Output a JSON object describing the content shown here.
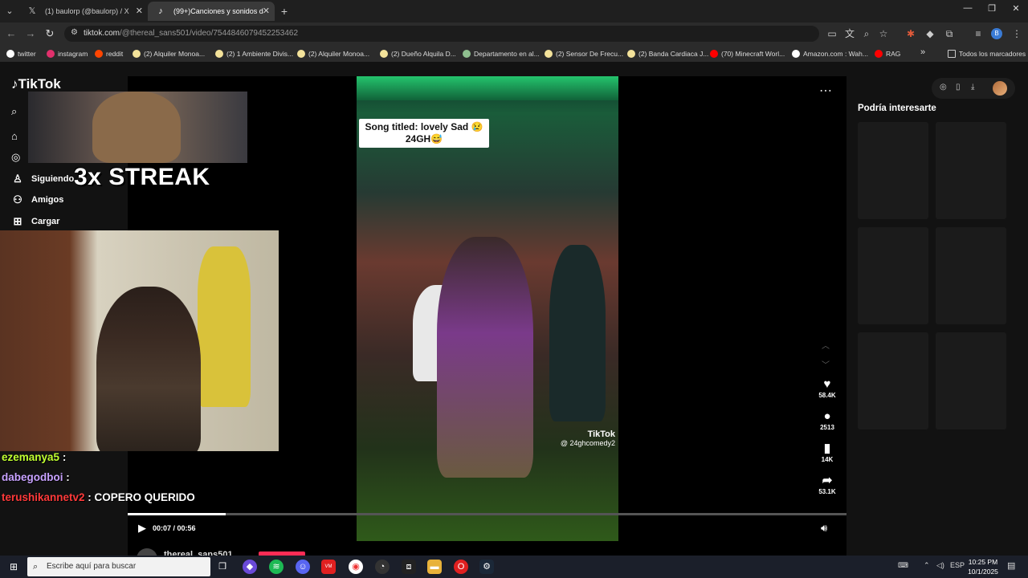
{
  "browser": {
    "tabs": [
      {
        "title": "(1) baulorp (@baulorp) / X",
        "icon": "x-logo-icon"
      },
      {
        "title": "(99+)Canciones y sonidos d",
        "icon": "tiktok-icon"
      }
    ],
    "url_domain": "tiktok.com",
    "url_path": "/@thereal_sans501/video/7544846079452253462",
    "bookmarks": [
      {
        "label": "twitter",
        "color": "#ffffff"
      },
      {
        "label": "instagram",
        "color": "#e1306c"
      },
      {
        "label": "reddit",
        "color": "#ff4500"
      },
      {
        "label": "(2) Alquiler Monoa...",
        "color": "#f3e29a"
      },
      {
        "label": "(2) 1 Ambiente Divis...",
        "color": "#f3e29a"
      },
      {
        "label": "(2) Alquiler Monoa...",
        "color": "#f3e29a"
      },
      {
        "label": "(2) Dueño Alquila D...",
        "color": "#f3e29a"
      },
      {
        "label": "Departamento en al...",
        "color": "#8fbf8f"
      },
      {
        "label": "(2) Sensor De Frecu...",
        "color": "#f3e29a"
      },
      {
        "label": "(2) Banda Cardiaca J...",
        "color": "#f3e29a"
      },
      {
        "label": "(70) Minecraft Worl...",
        "color": "#ff0000"
      },
      {
        "label": "Amazon.com : Wah...",
        "color": "#ffffff"
      },
      {
        "label": "RAG",
        "color": "#ff0000"
      }
    ],
    "more_bookmarks": "»",
    "all_bookmarks": "Todos los marcadores",
    "profile_initial": "B"
  },
  "tiktok": {
    "logo": "TikTok",
    "nav": [
      {
        "label": "Siguiendo",
        "icon": "following-icon"
      },
      {
        "label": "Amigos",
        "icon": "friends-icon"
      },
      {
        "label": "Cargar",
        "icon": "upload-icon"
      }
    ],
    "video": {
      "caption": "Song titled: lovely Sad 😢 24GH😅",
      "watermark": "TikTok",
      "watermark_handle": "@ 24ghcomedy2"
    },
    "actions": {
      "likes": "58.4K",
      "comments": "2513",
      "saves": "14K",
      "shares": "53.1K"
    },
    "playback": {
      "time": "00:07 / 00:56",
      "progress": 0.136
    },
    "author": "thereal_sans501",
    "suggest_title": "Podría interesarte",
    "accent": "#fe2c55"
  },
  "overlay": {
    "streak": "3x STREAK",
    "chat": [
      {
        "user": "ezemanya5",
        "msg": "",
        "color": "#c0ff30"
      },
      {
        "user": "dabegodboi",
        "msg": "",
        "color": "#c8a2ff"
      },
      {
        "user": "terushikannetv2",
        "msg": "COPERO QUERIDO",
        "color": "#ff3a3a"
      }
    ]
  },
  "taskbar": {
    "search_placeholder": "Escribe aquí para buscar",
    "lang": "ESP",
    "time": "10:25 PM",
    "date": "10/1/2025"
  }
}
